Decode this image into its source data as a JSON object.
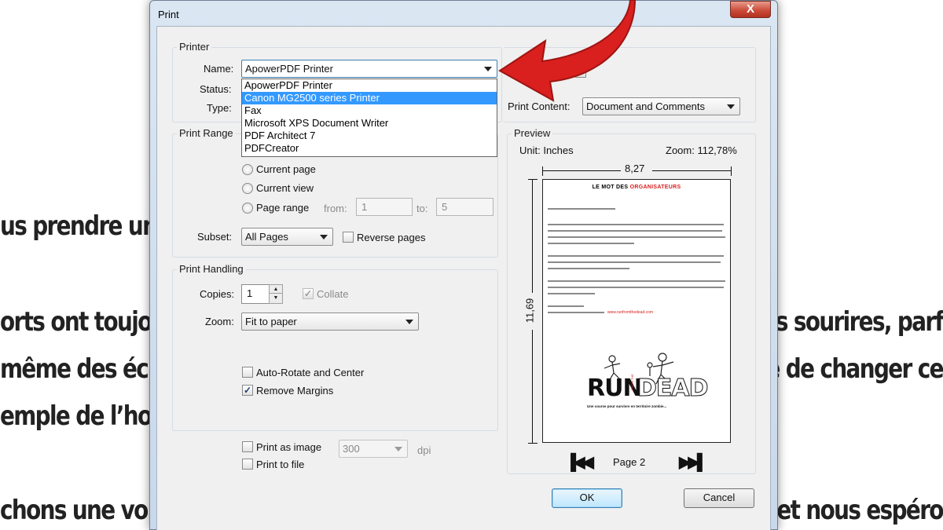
{
  "background": {
    "left_lines": [
      "us prendre un",
      "orts ont toujou",
      "même des écl",
      "emple de l’ho",
      "chons une vol"
    ],
    "right_lines": [
      "es sourires, parf",
      "e de changer ce",
      "et nous espéro"
    ]
  },
  "dialog": {
    "title": "Print",
    "close_label": "X"
  },
  "printer": {
    "group_label": "Printer",
    "name_label": "Name:",
    "name_value": "ApowerPDF Printer",
    "status_label": "Status:",
    "type_label": "Type:",
    "options": [
      {
        "label": "ApowerPDF Printer",
        "selected": false
      },
      {
        "label": "Canon MG2500 series Printer",
        "selected": true
      },
      {
        "label": "Fax",
        "selected": false
      },
      {
        "label": "Microsoft XPS Document Writer",
        "selected": false
      },
      {
        "label": "PDF Architect 7",
        "selected": false
      },
      {
        "label": "PDFCreator",
        "selected": false
      }
    ],
    "print_content_label": "Print Content:",
    "print_content_value": "Document and Comments"
  },
  "print_range": {
    "group_label": "Print Range",
    "current_page": "Current page",
    "current_view": "Current view",
    "page_range": "Page range",
    "from_label": "from:",
    "from_value": "1",
    "to_label": "to:",
    "to_value": "5",
    "subset_label": "Subset:",
    "subset_value": "All Pages",
    "reverse_pages": "Reverse pages"
  },
  "print_handling": {
    "group_label": "Print Handling",
    "copies_label": "Copies:",
    "copies_value": "1",
    "collate": "Collate",
    "zoom_label": "Zoom:",
    "zoom_value": "Fit to paper",
    "auto_rotate": "Auto-Rotate and Center",
    "remove_margins": "Remove Margins",
    "remove_margins_checked": true,
    "collate_checked": true
  },
  "output": {
    "print_as_image": "Print as image",
    "dpi_value": "300",
    "dpi_label": "dpi",
    "print_to_file": "Print to file"
  },
  "preview": {
    "group_label": "Preview",
    "unit": "Unit: Inches",
    "zoom": "Zoom: 112,78%",
    "width": "8,27",
    "height": "11,69",
    "page_label": "Page 2",
    "doc_heading_a": "LE MOT DES",
    "doc_heading_b": "ORGANISATEURS",
    "doc_link": "www.runfromthedead.com",
    "logo_run": "RUN",
    "logo_from": "FROM THE",
    "logo_dead": "DEAD",
    "logo_tagline": "Une course pour survivre en territoire zombie..."
  },
  "buttons": {
    "ok": "OK",
    "cancel": "Cancel"
  },
  "colors": {
    "selection": "#3399ff",
    "arrow": "#d9201f",
    "doc_accent": "#d9201f"
  }
}
